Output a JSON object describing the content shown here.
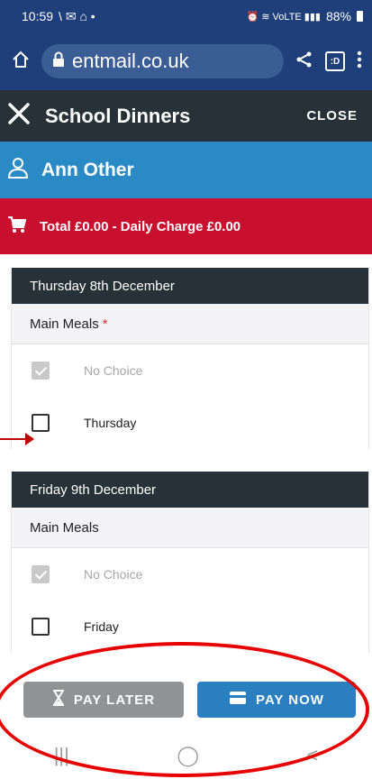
{
  "status_bar": {
    "time": "10:59",
    "left_glyphs": "\\ ✉ ⌂ •",
    "right_glyphs": "⏰ ≋ VoLTE ▮▮▮",
    "battery": "88%"
  },
  "browser": {
    "url": "entmail.co.uk",
    "home_icon": "home-icon",
    "share_icon": "share-icon",
    "tabs_label": ":D",
    "menu_icon": "more-vert-icon"
  },
  "header": {
    "title": "School Dinners",
    "close_label": "CLOSE"
  },
  "user": {
    "name": "Ann Other"
  },
  "total": {
    "text": "Total £0.00 - Daily Charge £0.00"
  },
  "days": [
    {
      "date": "Thursday 8th December",
      "section_label": "Main Meals",
      "required_mark": "*",
      "options": [
        {
          "label": "No Choice",
          "checked": true,
          "disabled": true
        },
        {
          "label": "Thursday",
          "checked": false,
          "disabled": false
        }
      ]
    },
    {
      "date": "Friday 9th December",
      "section_label": "Main Meals",
      "options": [
        {
          "label": "No Choice",
          "checked": true,
          "disabled": true
        },
        {
          "label": "Friday",
          "checked": false,
          "disabled": false
        }
      ]
    }
  ],
  "footer": {
    "pay_later_label": "PAY LATER",
    "pay_now_label": "PAY NOW"
  },
  "nav": {
    "recents_icon": "|||",
    "home_icon": "◯",
    "back_icon": "<"
  },
  "colors": {
    "header_dark": "#263238",
    "user_bar_blue": "#2a8ac6",
    "total_bar_red": "#c8102e",
    "pay_now_blue": "#2a7fc1",
    "pay_later_grey": "#909294",
    "annotation_red": "#e60000"
  }
}
